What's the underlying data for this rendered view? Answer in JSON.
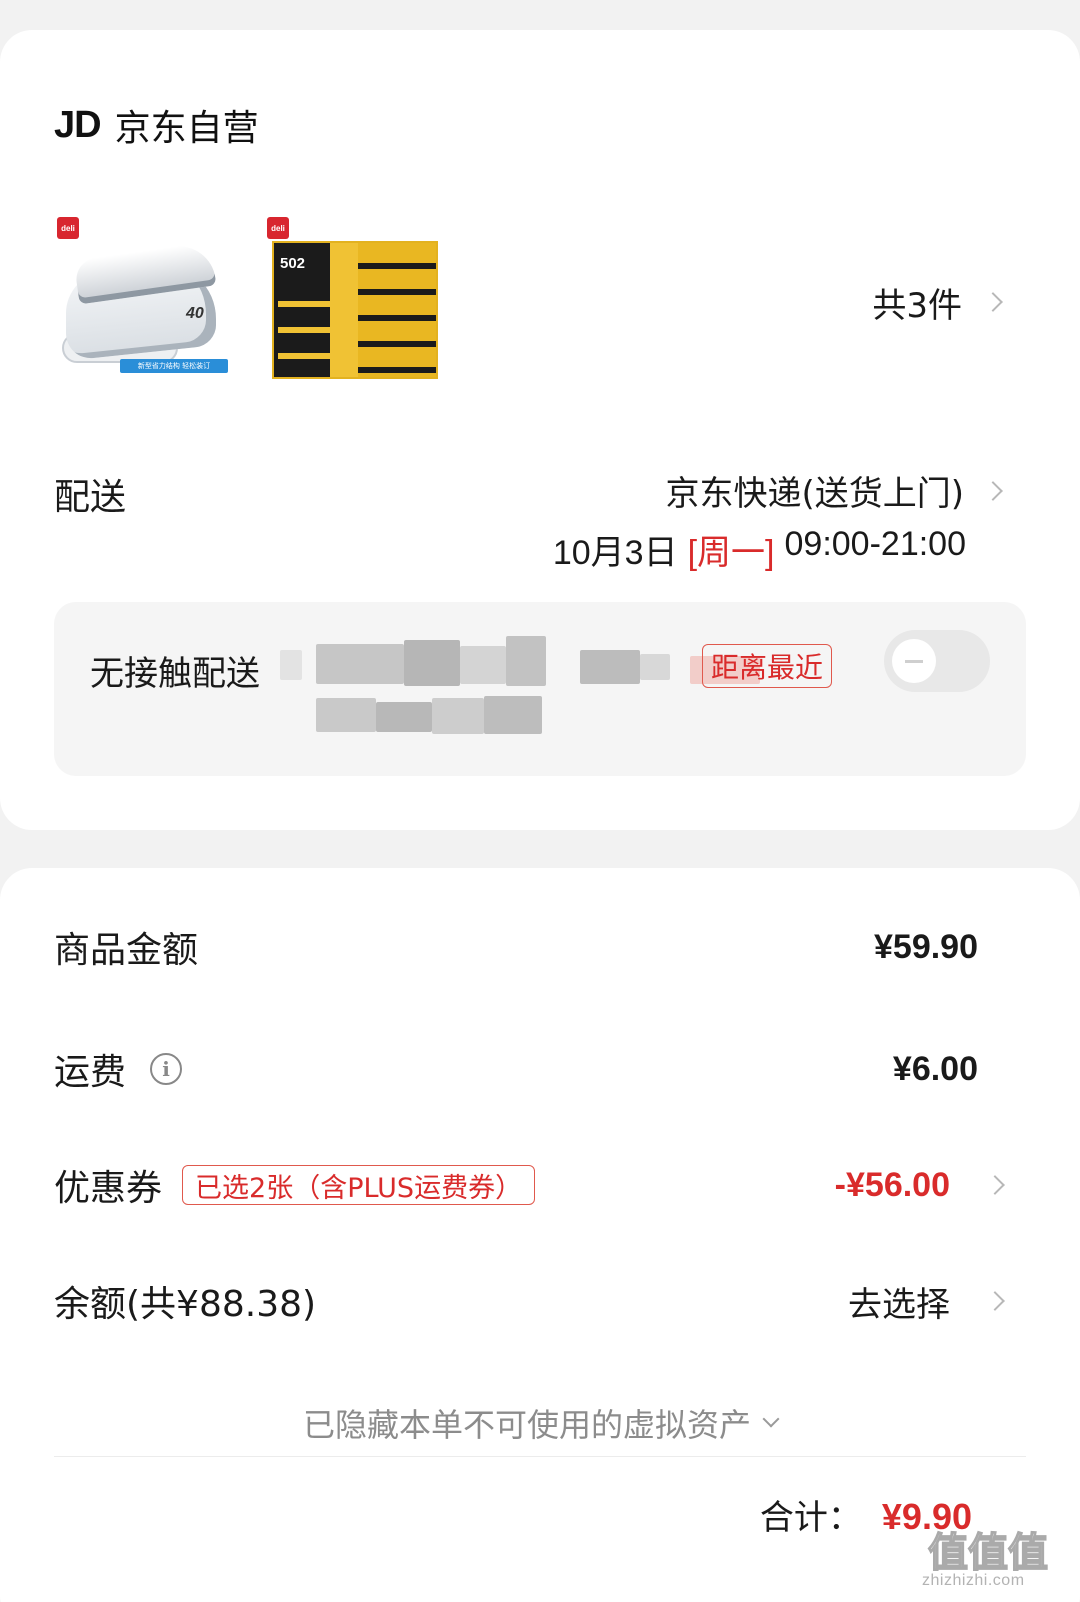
{
  "shop": {
    "logo_text": "JD",
    "name": "京东自营"
  },
  "products": {
    "items": [
      {
        "badge": "deli",
        "model_text": "40",
        "strip_text": "新型省力结构 轻松装订"
      },
      {
        "badge": "deli",
        "tag_text": "502"
      }
    ],
    "count_label": "共3件"
  },
  "delivery": {
    "label": "配送",
    "method": "京东快递(送货上门)",
    "date": "10月3日",
    "weekday": "[周一]",
    "time": "09:00-21:00"
  },
  "contactless": {
    "label": "无接触配送",
    "nearest_tag": "距离最近",
    "toggle_on": false
  },
  "fees": {
    "goods": {
      "label": "商品金额",
      "value": "¥59.90"
    },
    "shipping": {
      "label": "运费",
      "value": "¥6.00"
    },
    "coupon": {
      "label": "优惠券",
      "tag": "已选2张（含PLUS运费券）",
      "value": "-¥56.00"
    },
    "balance": {
      "label": "余额(共¥88.38)",
      "action": "去选择"
    }
  },
  "hidden_assets": "已隐藏本单不可使用的虚拟资产",
  "total": {
    "label": "合计：",
    "value": "¥9.90"
  },
  "watermark": {
    "brand": "值值值",
    "url": "zhizhizhi.com"
  },
  "colors": {
    "accent_red": "#d92b2b",
    "card_bg": "#ffffff",
    "page_bg": "#f2f2f2"
  }
}
